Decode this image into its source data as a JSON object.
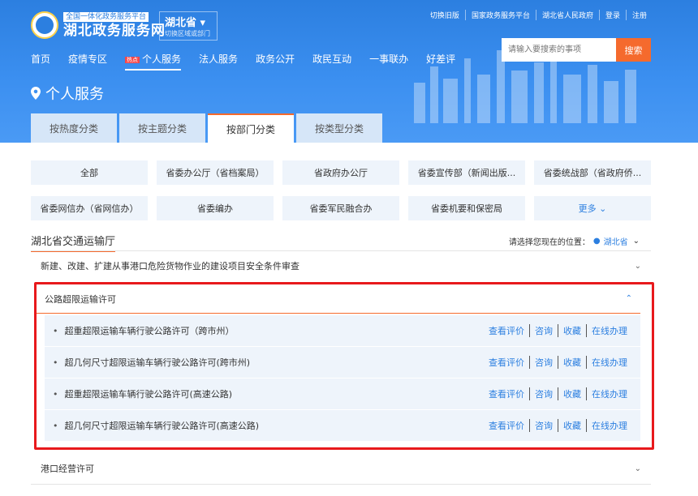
{
  "header": {
    "logo_sub": "全国一体化政务服务平台",
    "logo_main": "湖北政务服务网",
    "region": "湖北省",
    "region_sub": "切换区域或部门",
    "top_links": [
      "切换旧版",
      "国家政务服务平台",
      "湖北省人民政府",
      "登录",
      "注册"
    ],
    "search_placeholder": "请输入要搜索的事项",
    "search_button": "搜索",
    "nav": [
      "首页",
      "疫情专区",
      "个人服务",
      "法人服务",
      "政务公开",
      "政民互动",
      "一事联办",
      "好差评"
    ],
    "nav_badge": "热点",
    "page_title": "个人服务",
    "tabs": [
      "按热度分类",
      "按主题分类",
      "按部门分类",
      "按类型分类"
    ]
  },
  "departments": [
    [
      "全部",
      "省委办公厅（省档案局）",
      "省政府办公厅",
      "省委宣传部（新闻出版...",
      "省委统战部（省政府侨..."
    ],
    [
      "省委网信办（省网信办）",
      "省委编办",
      "省委军民融合办",
      "省委机要和保密局",
      "更多 ⌄"
    ]
  ],
  "dept": {
    "title": "湖北省交通运输厅",
    "location_label": "请选择您现在的位置：",
    "location_value": "湖北省"
  },
  "accordions": {
    "first": "新建、改建、扩建从事港口危险货物作业的建设项目安全条件审查",
    "expanded": "公路超限运输许可",
    "last": "港口经营许可"
  },
  "items": [
    {
      "name": "超重超限运输车辆行驶公路许可（跨市州）"
    },
    {
      "name": "超几何尺寸超限运输车辆行驶公路许可(跨市州)"
    },
    {
      "name": "超重超限运输车辆行驶公路许可(高速公路)"
    },
    {
      "name": "超几何尺寸超限运输车辆行驶公路许可(高速公路)"
    }
  ],
  "actions": [
    "查看评价",
    "咨询",
    "收藏",
    "在线办理"
  ]
}
